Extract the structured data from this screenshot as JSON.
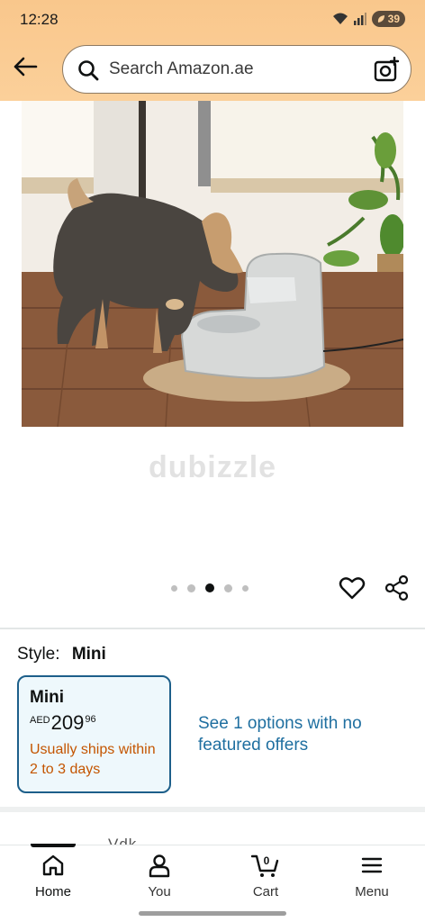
{
  "status_bar": {
    "time": "12:28",
    "battery": "39"
  },
  "header": {
    "search": {
      "placeholder": "Search Amazon.ae"
    }
  },
  "gallery": {
    "watermark": "dubizzle",
    "image_count": 5,
    "active_index": 2
  },
  "style_selector": {
    "label": "Style:",
    "selected": "Mini",
    "option": {
      "name": "Mini",
      "currency": "AED",
      "price_whole": "209",
      "price_fraction": "96",
      "shipping": "Usually ships within 2 to 3 days"
    },
    "see_options": "See 1 options with no featured offers"
  },
  "partial_text": "Vdk...",
  "bottom_nav": {
    "items": [
      {
        "label": "Home",
        "icon": "home-icon",
        "active": true
      },
      {
        "label": "You",
        "icon": "person-icon",
        "active": false
      },
      {
        "label": "Cart",
        "icon": "cart-icon",
        "cart_count": "0",
        "active": false
      },
      {
        "label": "Menu",
        "icon": "menu-icon",
        "active": false
      }
    ]
  },
  "colors": {
    "header_orange": "#fbd09a",
    "link_blue": "#1f6fa0",
    "shipping_orange": "#c45500",
    "card_border": "#1d5f8a"
  }
}
